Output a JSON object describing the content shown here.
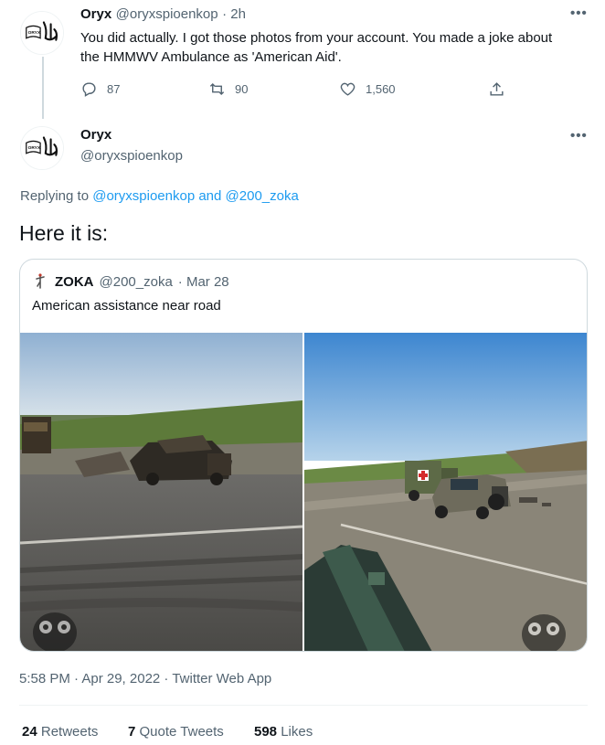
{
  "reply_tweet": {
    "author_name": "Oryx",
    "author_handle": "@oryxspioenkop",
    "time": "· 2h",
    "text": "You did actually. I got those photos from your account. You made a joke about the HMMWV Ambulance as 'American Aid'.",
    "actions": {
      "replies": "87",
      "retweets": "90",
      "likes": "1,560"
    },
    "icons": [
      "reply-icon",
      "retweet-icon",
      "like-icon",
      "share-icon",
      "more-icon"
    ]
  },
  "main_tweet": {
    "author_name": "Oryx",
    "author_handle": "@oryxspioenkop",
    "replying_prefix": "Replying to",
    "replying_to_1": "@oryxspioenkop",
    "replying_and": "and",
    "replying_to_2": "@200_zoka",
    "text": "Here it is:",
    "timestamp": "5:58 PM · Apr 29, 2022 · Twitter Web App",
    "stats": {
      "retweets_count": "24",
      "retweets_label": "Retweets",
      "quotes_count": "7",
      "quotes_label": "Quote Tweets",
      "likes_count": "598",
      "likes_label": "Likes"
    }
  },
  "quoted_tweet": {
    "author_name": "ZOKA",
    "author_handle": "@200_zoka",
    "time": "· Mar 28",
    "text": "American assistance near road"
  },
  "avatar_logo_text": "ORYX",
  "colors": {
    "link": "#1d9bf0",
    "muted": "#536471",
    "text": "#0f1419",
    "border": "#cfd9de"
  }
}
